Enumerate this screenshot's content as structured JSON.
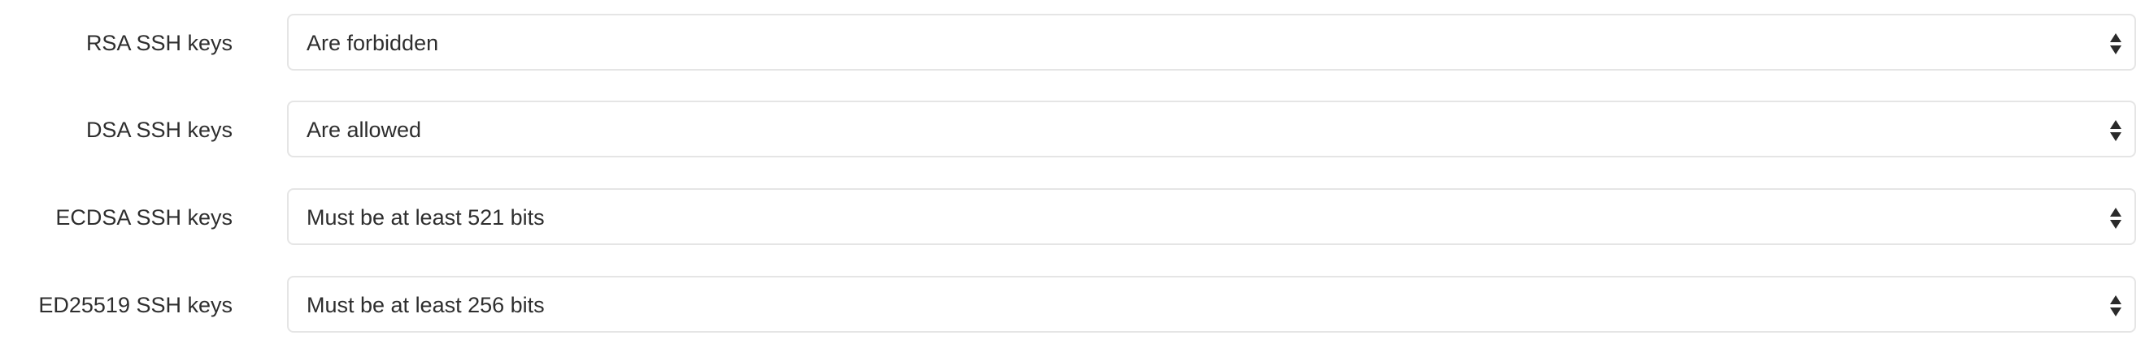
{
  "settings": [
    {
      "label": "RSA SSH keys",
      "value": "Are forbidden"
    },
    {
      "label": "DSA SSH keys",
      "value": "Are allowed"
    },
    {
      "label": "ECDSA SSH keys",
      "value": "Must be at least 521 bits"
    },
    {
      "label": "ED25519 SSH keys",
      "value": "Must be at least 256 bits"
    }
  ],
  "icons": {
    "select_arrow": "sort-arrows-icon"
  }
}
